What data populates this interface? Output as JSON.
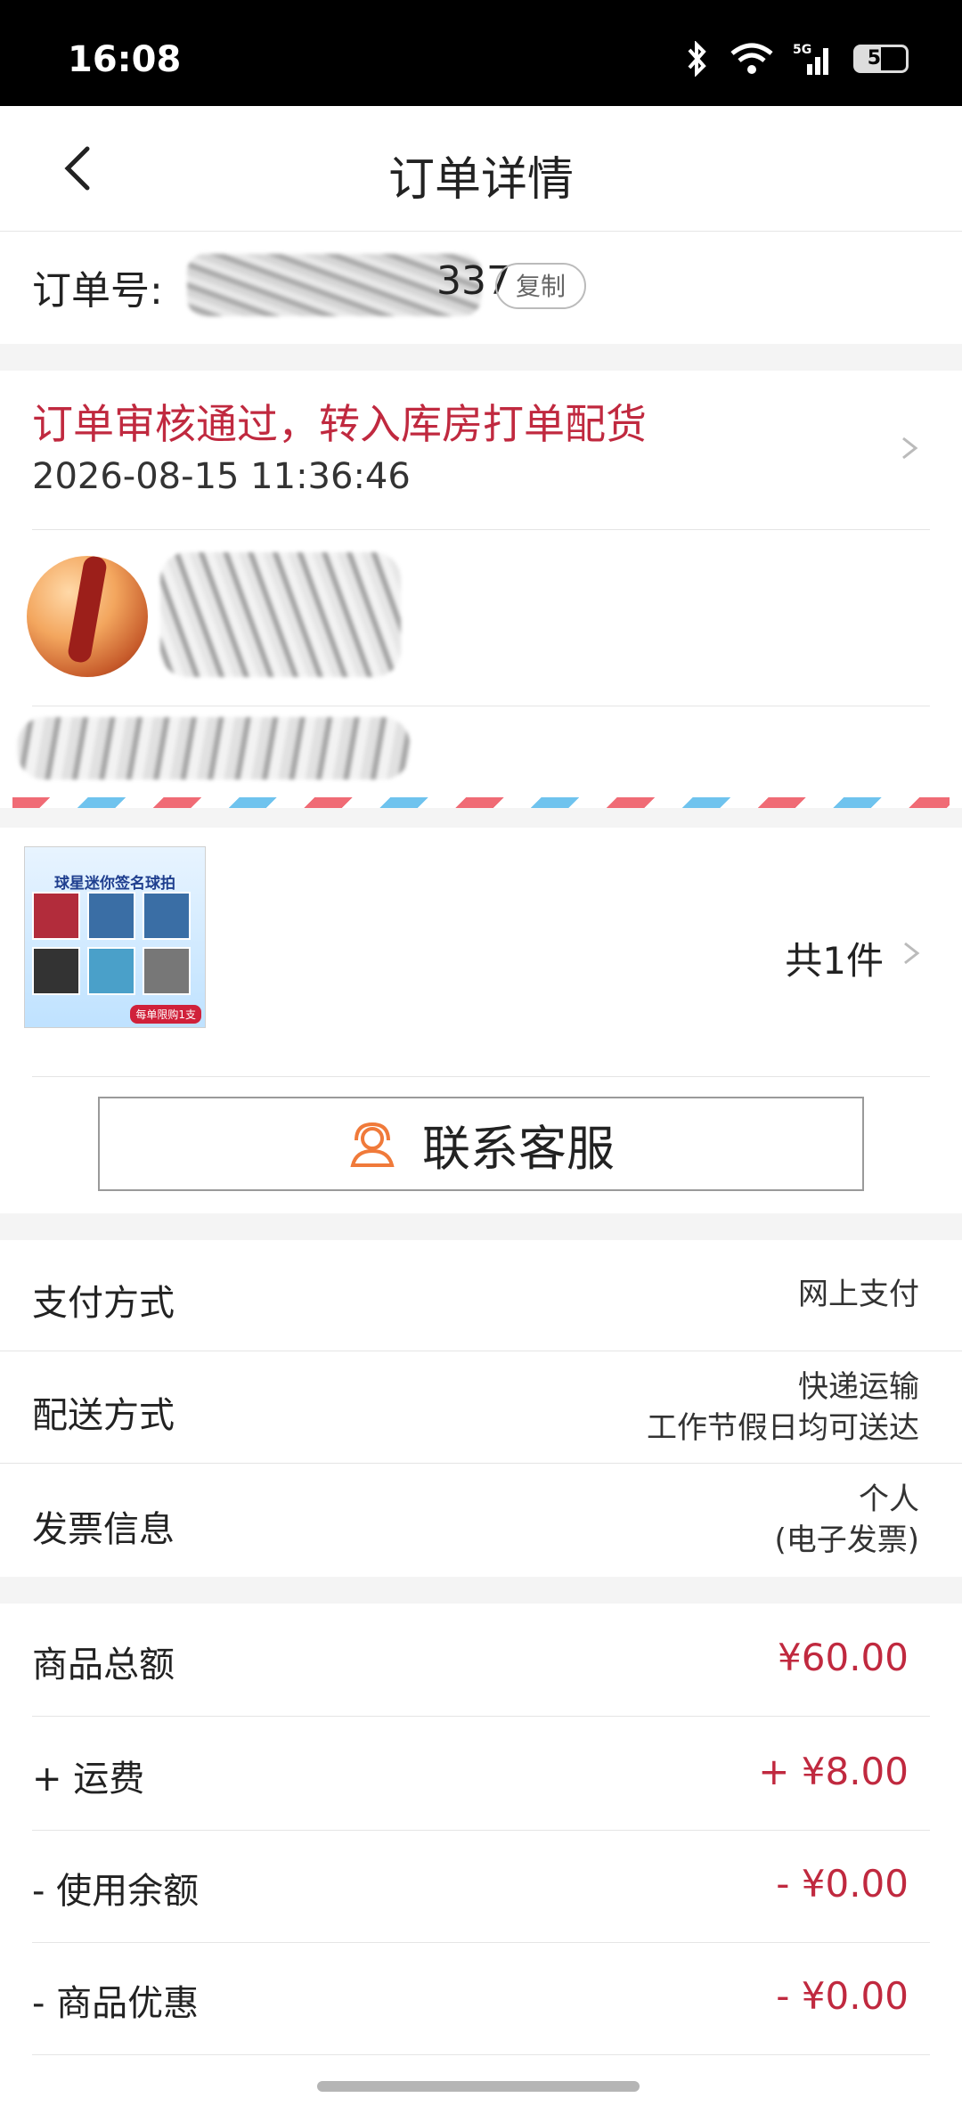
{
  "status_bar": {
    "time": "16:08",
    "battery": "50"
  },
  "nav": {
    "title": "订单详情"
  },
  "order": {
    "number_label": "订单号:",
    "number_tail": "337",
    "copy_label": "复制"
  },
  "status": {
    "message": "订单审核通过，转入库房打单配货",
    "time": "2026-08-15 11:36:46"
  },
  "product": {
    "thumb_title": "球星迷你签名球拍",
    "thumb_badge": "每单限购1支",
    "quantity": "共1件"
  },
  "contact": {
    "label": "联系客服"
  },
  "info_rows": [
    {
      "label": "支付方式",
      "value_lines": [
        "网上支付"
      ]
    },
    {
      "label": "配送方式",
      "value_lines": [
        "快递运输",
        "工作节假日均可送达"
      ]
    },
    {
      "label": "发票信息",
      "value_lines": [
        "个人",
        "(电子发票)"
      ]
    }
  ],
  "price_rows": [
    {
      "label": "商品总额",
      "value": "¥60.00"
    },
    {
      "label": "+ 运费",
      "value": "+ ¥8.00"
    },
    {
      "label": "- 使用余额",
      "value": "- ¥0.00"
    },
    {
      "label": "- 商品优惠",
      "value": "- ¥0.00"
    }
  ],
  "colors": {
    "accent": "#c0293f",
    "service_icon": "#f07a3a"
  }
}
